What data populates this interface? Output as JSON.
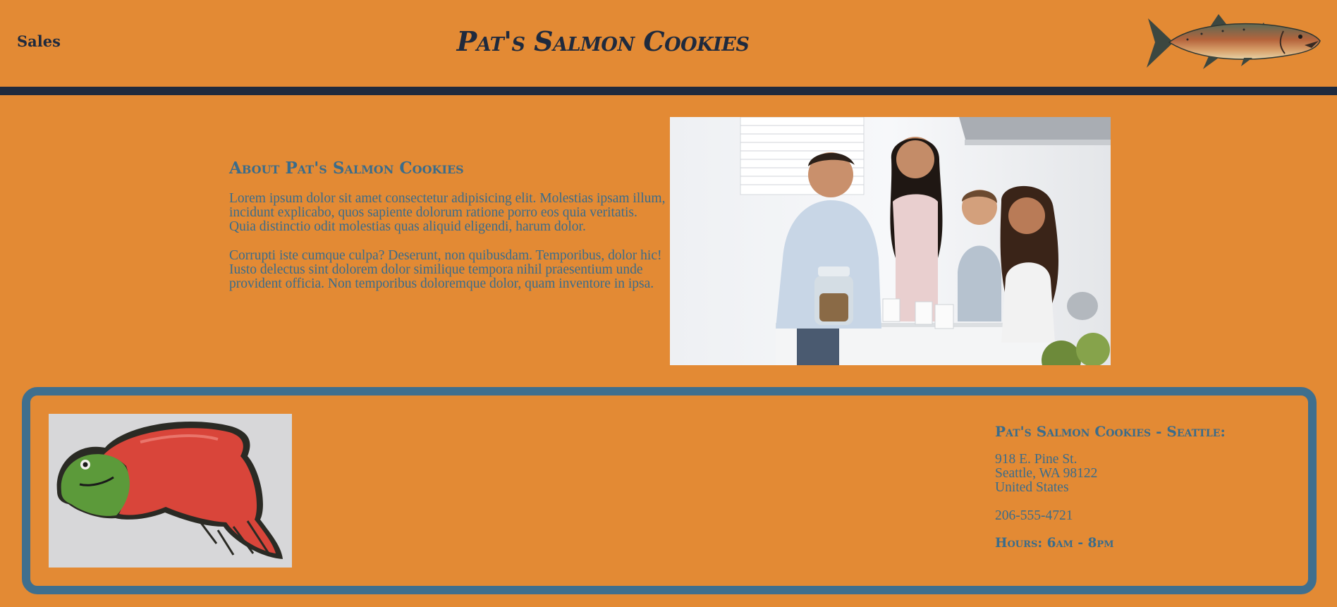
{
  "header": {
    "nav_link": "Sales",
    "title": "Pat's Salmon Cookies",
    "logo_icon": "salmon-fish-icon"
  },
  "colors": {
    "background": "#e38a34",
    "navy": "#1f2a3d",
    "steel_blue": "#3a6c8b",
    "footer_border": "#3f6f8e"
  },
  "about": {
    "heading": "About Pat's Salmon Cookies",
    "paragraphs": [
      "Lorem ipsum dolor sit amet consectetur adipisicing elit. Molestias ipsam illum, incidunt explicabo, quos sapiente dolorum ratione porro eos quia veritatis. Quia distinctio odit molestias quas aliquid eligendi, harum dolor.",
      "Corrupti iste cumque culpa? Deserunt, non quibusdam. Temporibus, dolor hic! Iusto delectus sint dolorem dolor similique tempora nihil praesentium unde provident officia. Non temporibus doloremque dolor, quam inventore in ipsa."
    ],
    "photo": "family-with-cookies-photo"
  },
  "footer": {
    "photo": "salmon-cookie-photo",
    "location_heading": "Pat's Salmon Cookies - Seattle:",
    "address": [
      "918 E. Pine St.",
      "Seattle, WA 98122",
      "United States"
    ],
    "phone": "206-555-4721",
    "hours": "Hours: 6am - 8pm"
  }
}
